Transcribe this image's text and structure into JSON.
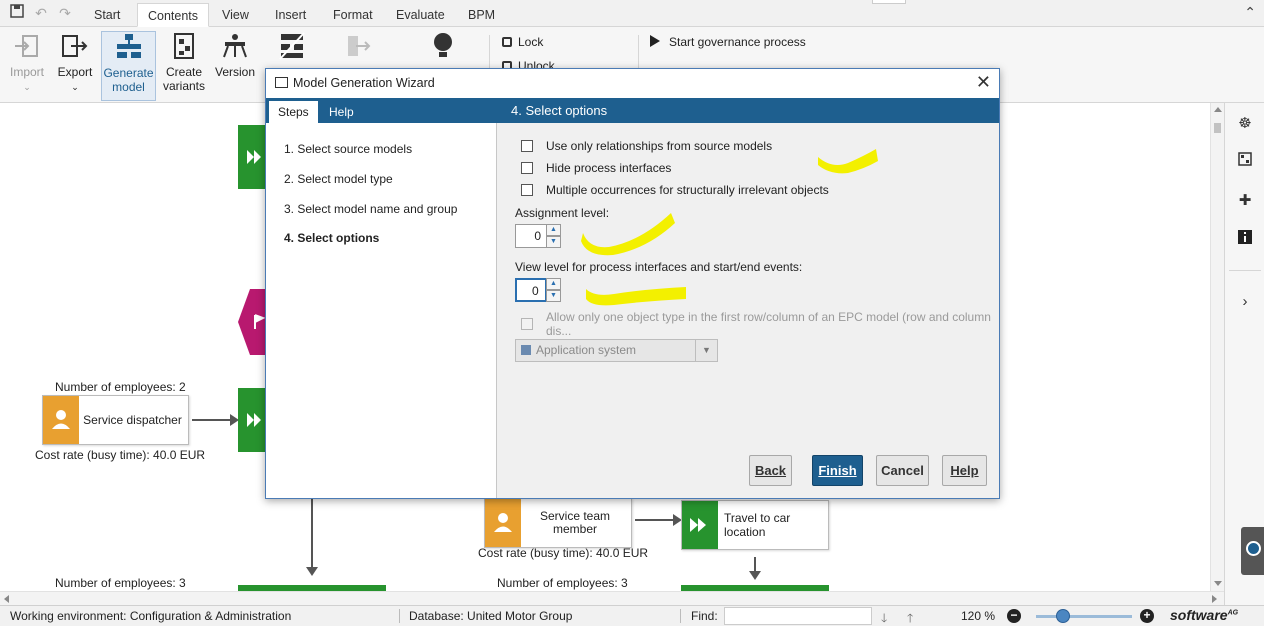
{
  "menubar": {
    "tabs": [
      {
        "label": "Start"
      },
      {
        "label": "Contents"
      },
      {
        "label": "View"
      },
      {
        "label": "Insert"
      },
      {
        "label": "Format"
      },
      {
        "label": "Evaluate"
      },
      {
        "label": "BPM"
      }
    ]
  },
  "ribbon": {
    "import": "Import",
    "export": "Export",
    "generate_model_1": "Generate",
    "generate_model_2": "model",
    "create_variants_1": "Create",
    "create_variants_2": "variants",
    "version": "Version",
    "lock": "Lock",
    "unlock": "Unlock",
    "start_governance": "Start governance process"
  },
  "canvas": {
    "employees_left": "Number of employees: 2",
    "dispatcher": "Service dispatcher",
    "cost_left": "Cost rate (busy time): 40.0 EUR",
    "employees_bottom_left": "Number of employees: 3",
    "team_member_1": "Service team",
    "team_member_2": "member",
    "cost_mid": "Cost rate (busy time): 40.0 EUR",
    "travel": "Travel to car location",
    "employees_bottom_mid": "Number of employees: 3"
  },
  "dialog": {
    "title": "Model Generation Wizard",
    "tabs": {
      "steps": "Steps",
      "help": "Help"
    },
    "steps": [
      {
        "label": "1. Select source models"
      },
      {
        "label": "2. Select model type"
      },
      {
        "label": "3. Select model name and group"
      },
      {
        "label": "4. Select options"
      }
    ],
    "header": "4. Select options",
    "options": {
      "use_only_relationships": "Use only relationships from source models",
      "hide_process_interfaces": "Hide process interfaces",
      "multiple_occurrences": "Multiple occurrences for structurally irrelevant objects",
      "assignment_level_label": "Assignment level:",
      "assignment_level_value": "0",
      "view_level_label": "View level for process interfaces and start/end events:",
      "view_level_value": "0",
      "allow_one_object_type": "Allow only one object type in the first row/column of an EPC model (row and column dis...",
      "object_type_value": "Application system"
    },
    "buttons": {
      "back": "Back",
      "finish": "Finish",
      "cancel": "Cancel",
      "help": "Help"
    }
  },
  "statusbar": {
    "environment": "Working environment: Configuration & Administration",
    "database": "Database: United Motor Group",
    "find": "Find:",
    "zoom": "120 %",
    "brand": "software",
    "brand_suffix": "AG"
  },
  "colors": {
    "accent": "#1e5f8f",
    "function_green": "#27932e",
    "role_orange": "#e8a030",
    "event_magenta": "#b8196f",
    "highlight_yellow": "#f3f000"
  }
}
